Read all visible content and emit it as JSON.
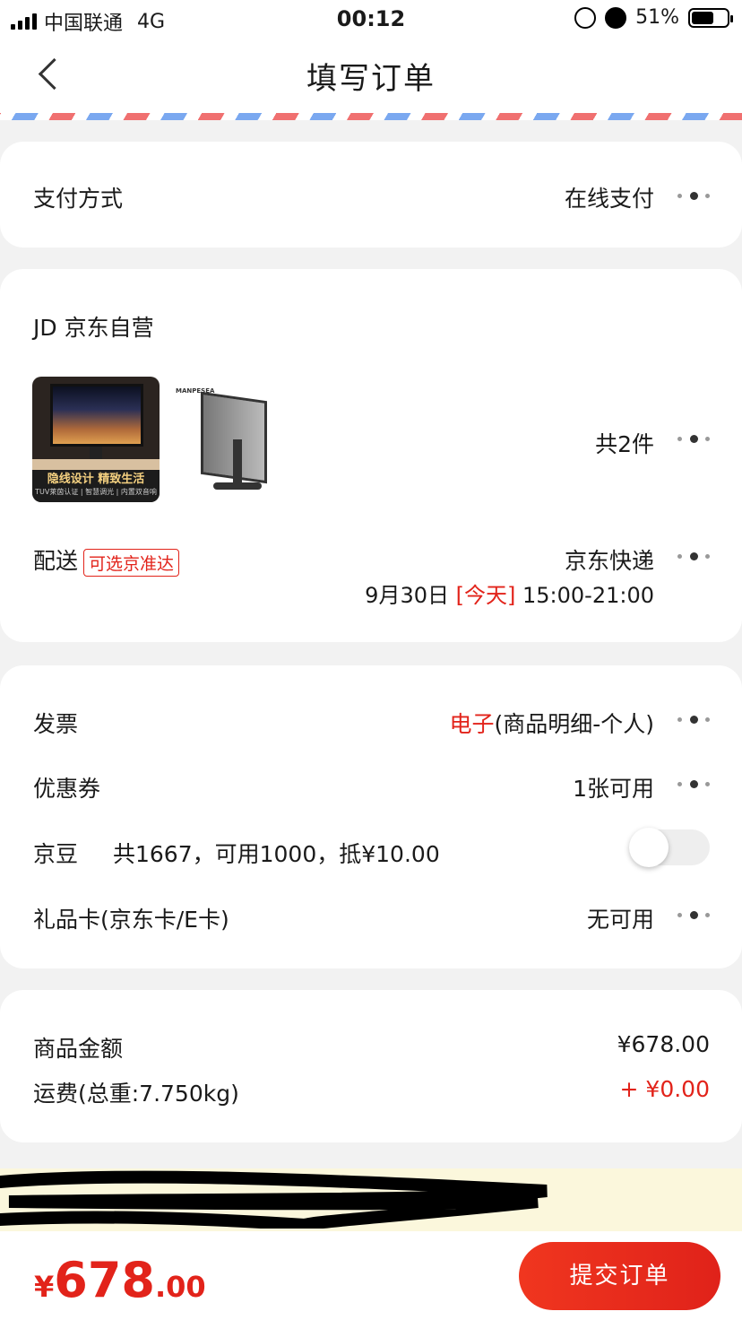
{
  "status_bar": {
    "carrier": "中国联通",
    "network": "4G",
    "time": "00:12",
    "battery": "51%"
  },
  "nav": {
    "title": "填写订单"
  },
  "payment": {
    "label": "支付方式",
    "value": "在线支付"
  },
  "shop": {
    "name": "JD 京东自营"
  },
  "products": {
    "count_prefix": "共",
    "count": "2",
    "count_suffix": "件",
    "thumb1_banner": "隐线设计 精致生活",
    "thumb1_sub": "TUV莱茵认证 | 智慧调光 | 内置双音响",
    "thumb2_brand": "MANPESEA"
  },
  "delivery": {
    "label": "配送",
    "tag": "可选京准达",
    "carrier": "京东快递",
    "date": "9月30日",
    "today": "[今天]",
    "time_range": "15:00-21:00"
  },
  "invoice": {
    "label": "发票",
    "value_type": "电子",
    "value_detail": "(商品明细-个人)"
  },
  "coupon": {
    "label": "优惠券",
    "value": "1张可用"
  },
  "beans": {
    "label": "京豆",
    "detail": "共1667，可用1000，抵¥10.00",
    "enabled": false
  },
  "gift_card": {
    "label": "礼品卡(京东卡/E卡)",
    "value": "无可用"
  },
  "summary": {
    "goods_label": "商品金额",
    "goods_value": "¥678.00",
    "shipping_label": "运费(总重:7.750kg)",
    "shipping_value": "+ ¥0.00"
  },
  "footer": {
    "currency": "¥",
    "total_int": "678",
    "total_dec": ".00",
    "submit_label": "提交订单"
  },
  "colors": {
    "accent": "#e2231a",
    "notice_bg": "#fbf7dc"
  }
}
